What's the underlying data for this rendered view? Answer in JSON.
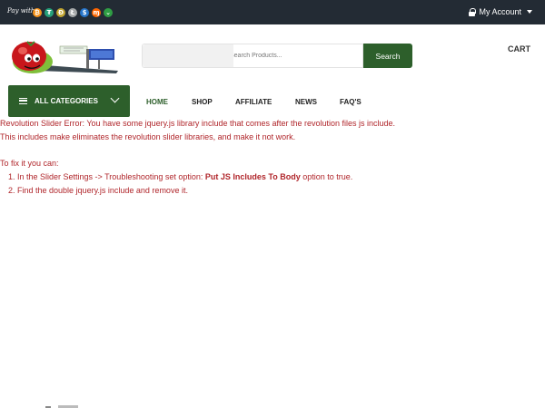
{
  "topbar": {
    "pay_with": "Pay with",
    "coins": [
      {
        "icon": "bitcoin-icon",
        "glyph": "₿",
        "color": "#f7931a"
      },
      {
        "icon": "tether-icon",
        "glyph": "₮",
        "color": "#26a17b"
      },
      {
        "icon": "dogecoin-icon",
        "glyph": "Ð",
        "color": "#c2a633"
      },
      {
        "icon": "litecoin-icon",
        "glyph": "Ł",
        "color": "#a6a9aa"
      },
      {
        "icon": "usdc-icon",
        "glyph": "$",
        "color": "#2775ca"
      },
      {
        "icon": "monero-icon",
        "glyph": "ɱ",
        "color": "#ff6600"
      },
      {
        "icon": "chevron-coin-icon",
        "glyph": "⌄",
        "color": "#2f9e44"
      }
    ],
    "account_label": "My Account"
  },
  "header": {
    "search_placeholder": "Search Products...",
    "search_button": "Search",
    "cart_label": "CART"
  },
  "nav": {
    "categories_label": "ALL CATEGORIES",
    "items": [
      "HOME",
      "SHOP",
      "AFFILIATE",
      "NEWS",
      "FAQ'S"
    ],
    "active_color": "#2d5f2b"
  },
  "error": {
    "line1": "Revolution Slider Error: You have some jquery.js library include that comes after the revolution files js include.",
    "line2": "This includes make eliminates the revolution slider libraries, and make it not work.",
    "fix_intro": "To fix it you can:",
    "step1_pre": "1. In the Slider Settings -> Troubleshooting set option: ",
    "step1_bold": "Put JS Includes To Body",
    "step1_post": " option to true.",
    "step2": "2. Find the double jquery.js include and remove it."
  },
  "colors": {
    "topbar": "#232b34",
    "brand_green": "#2d5f2b",
    "error_red": "#b0262b"
  }
}
